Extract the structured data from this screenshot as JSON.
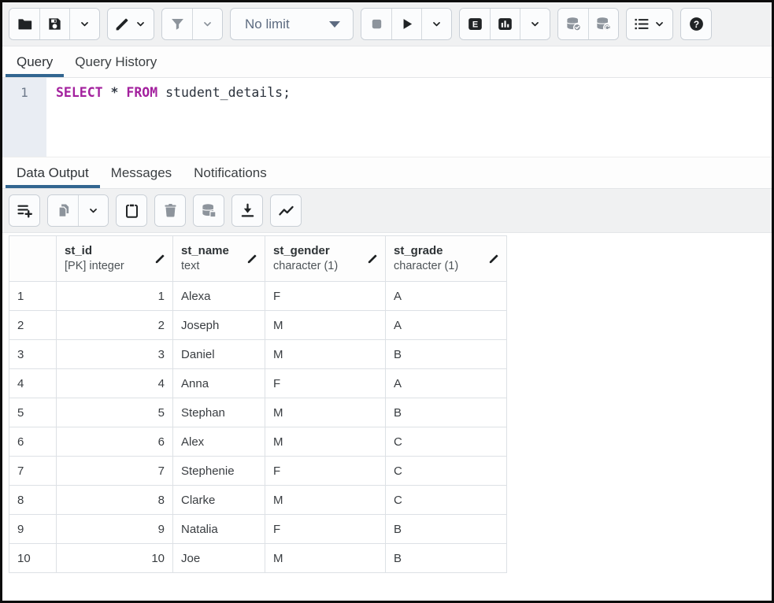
{
  "colors": {
    "accent": "#326690",
    "keyword": "#a3219e",
    "toolbar_bg": "#f0f1f2",
    "gutter_bg": "#e9edf3"
  },
  "toolbar_main": {
    "groups": [
      {
        "items": [
          {
            "icon": "folder",
            "name": "open-file-button",
            "enabled": true
          },
          {
            "icon": "save",
            "name": "save-file-button",
            "enabled": true
          },
          {
            "icon": "chevron",
            "name": "save-options-chevron",
            "enabled": true,
            "small": true
          }
        ]
      },
      {
        "items": [
          {
            "icon": "pencil",
            "name": "edit-options-button",
            "enabled": true,
            "with_chevron": true
          }
        ]
      },
      {
        "items": [
          {
            "icon": "filter",
            "name": "filter-button",
            "enabled": false
          },
          {
            "icon": "chevron",
            "name": "filter-options-chevron",
            "enabled": false,
            "small": true
          }
        ]
      },
      {
        "items": [
          {
            "icon": "stop",
            "name": "cancel-query-button",
            "enabled": false
          },
          {
            "icon": "play",
            "name": "execute-query-button",
            "enabled": true
          },
          {
            "icon": "chevron",
            "name": "execute-options-chevron",
            "enabled": true,
            "small": true
          }
        ]
      },
      {
        "items": [
          {
            "icon": "explain-badge",
            "name": "explain-button",
            "enabled": true
          },
          {
            "icon": "analyze-badge",
            "name": "explain-analyze-button",
            "enabled": true
          },
          {
            "icon": "chevron",
            "name": "explain-options-chevron",
            "enabled": true,
            "small": true
          }
        ]
      },
      {
        "items": [
          {
            "icon": "db-check",
            "name": "commit-button",
            "enabled": false
          },
          {
            "icon": "db-rollback",
            "name": "rollback-button",
            "enabled": false
          }
        ]
      },
      {
        "items": [
          {
            "icon": "macros",
            "name": "macros-button",
            "enabled": true,
            "with_chevron": true
          }
        ]
      },
      {
        "items": [
          {
            "icon": "help",
            "name": "help-button",
            "enabled": true
          }
        ]
      }
    ],
    "limit_select": {
      "value": "No limit",
      "name": "row-limit-select"
    },
    "select_after_group": 3
  },
  "query_tabs": {
    "tabs": [
      {
        "label": "Query",
        "active": true,
        "name": "tab-query"
      },
      {
        "label": "Query History",
        "active": false,
        "name": "tab-query-history"
      }
    ]
  },
  "editor": {
    "line_number": "1",
    "sql_tokens": [
      {
        "text": "SELECT",
        "type": "keyword"
      },
      {
        "text": " ",
        "type": "plain"
      },
      {
        "text": "*",
        "type": "operator"
      },
      {
        "text": " ",
        "type": "plain"
      },
      {
        "text": "FROM",
        "type": "keyword"
      },
      {
        "text": " student_details;",
        "type": "plain"
      }
    ]
  },
  "result_tabs": {
    "tabs": [
      {
        "label": "Data Output",
        "active": true,
        "name": "tab-data-output"
      },
      {
        "label": "Messages",
        "active": false,
        "name": "tab-messages"
      },
      {
        "label": "Notifications",
        "active": false,
        "name": "tab-notifications"
      }
    ]
  },
  "toolbar_results": {
    "groups": [
      {
        "items": [
          {
            "icon": "add-row",
            "name": "add-row-button",
            "enabled": true
          }
        ]
      },
      {
        "items": [
          {
            "icon": "copy",
            "name": "copy-button",
            "enabled": false
          },
          {
            "icon": "chevron",
            "name": "copy-options-chevron",
            "enabled": true,
            "small": true
          }
        ]
      },
      {
        "items": [
          {
            "icon": "paste",
            "name": "paste-button",
            "enabled": true
          }
        ]
      },
      {
        "items": [
          {
            "icon": "trash",
            "name": "delete-row-button",
            "enabled": false
          }
        ]
      },
      {
        "items": [
          {
            "icon": "db-save",
            "name": "save-data-changes-button",
            "enabled": false
          }
        ]
      },
      {
        "items": [
          {
            "icon": "download",
            "name": "save-results-to-file-button",
            "enabled": true
          }
        ]
      },
      {
        "items": [
          {
            "icon": "visualiser",
            "name": "graph-visualiser-button",
            "enabled": true
          }
        ]
      }
    ]
  },
  "grid": {
    "row_header_width": 60,
    "columns": [
      {
        "name": "st_id",
        "type": "[PK] integer",
        "width": 148,
        "align": "right"
      },
      {
        "name": "st_name",
        "type": "text",
        "width": 117,
        "align": "left"
      },
      {
        "name": "st_gender",
        "type": "character (1)",
        "width": 153,
        "align": "left"
      },
      {
        "name": "st_grade",
        "type": "character (1)",
        "width": 154,
        "align": "left"
      }
    ],
    "rows": [
      [
        "1",
        "Alexa",
        "F",
        "A"
      ],
      [
        "2",
        "Joseph",
        "M",
        "A"
      ],
      [
        "3",
        "Daniel",
        "M",
        "B"
      ],
      [
        "4",
        "Anna",
        "F",
        "A"
      ],
      [
        "5",
        "Stephan",
        "M",
        "B"
      ],
      [
        "6",
        "Alex",
        "M",
        "C"
      ],
      [
        "7",
        "Stephenie",
        "F",
        "C"
      ],
      [
        "8",
        "Clarke",
        "M",
        "C"
      ],
      [
        "9",
        "Natalia",
        "F",
        "B"
      ],
      [
        "10",
        "Joe",
        "M",
        "B"
      ]
    ]
  }
}
